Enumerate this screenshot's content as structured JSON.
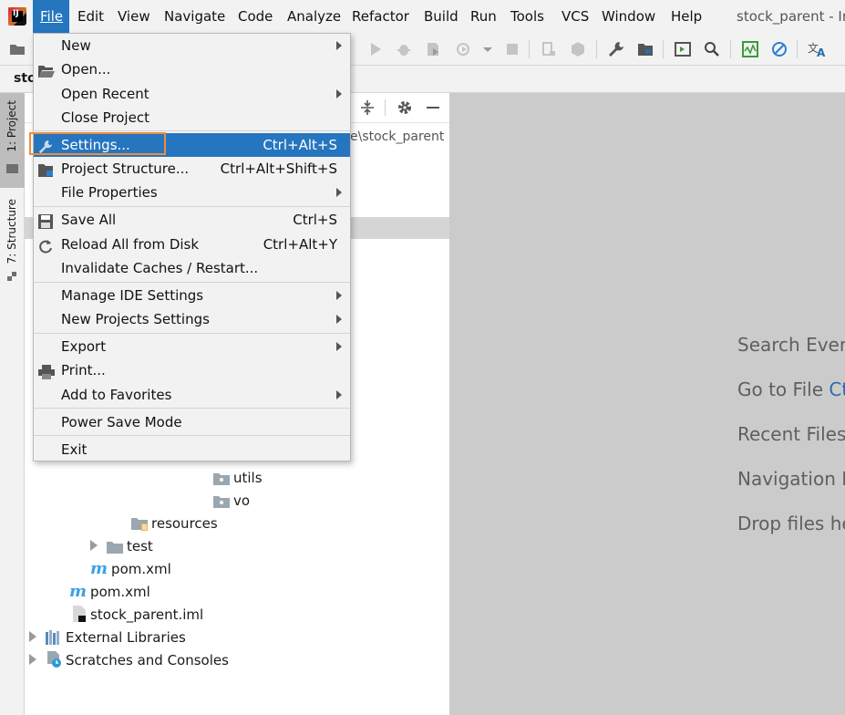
{
  "menubar": {
    "items": [
      "File",
      "Edit",
      "View",
      "Navigate",
      "Code",
      "Analyze",
      "Refactor",
      "Build",
      "Run",
      "Tools",
      "VCS",
      "Window",
      "Help"
    ],
    "window_title": "stock_parent - In"
  },
  "navbar": {
    "crumb": "stock"
  },
  "leftstrip": {
    "project_tab": "1: Project",
    "structure_tab": "7: Structure"
  },
  "project": {
    "path_fragment": "e\\stock_parent",
    "tree": [
      {
        "label": "utils",
        "kind": "folder"
      },
      {
        "label": "vo",
        "kind": "folder"
      },
      {
        "label": "resources",
        "kind": "resources"
      },
      {
        "label": "test",
        "kind": "folder"
      },
      {
        "label": "pom.xml",
        "kind": "maven"
      },
      {
        "label": "pom.xml",
        "kind": "maven"
      },
      {
        "label": "stock_parent.iml",
        "kind": "iml"
      },
      {
        "label": "External Libraries",
        "kind": "libraries"
      },
      {
        "label": "Scratches and Consoles",
        "kind": "scratches"
      }
    ]
  },
  "editor": {
    "hints": [
      {
        "text": "Search Every",
        "key": ""
      },
      {
        "text": "Go to File ",
        "key": "Ct"
      },
      {
        "text": "Recent Files",
        "key": ""
      },
      {
        "text": "Navigation B",
        "key": ""
      },
      {
        "text": "Drop files he",
        "key": ""
      }
    ]
  },
  "file_menu": {
    "items": [
      {
        "label": "New",
        "shortcut": "",
        "submenu": true
      },
      {
        "label": "Open...",
        "shortcut": "",
        "submenu": false,
        "icon": "folder-open-icon"
      },
      {
        "label": "Open Recent",
        "shortcut": "",
        "submenu": true
      },
      {
        "label": "Close Project",
        "shortcut": "",
        "submenu": false
      },
      {
        "label": "Settings...",
        "shortcut": "Ctrl+Alt+S",
        "submenu": false,
        "icon": "wrench-icon"
      },
      {
        "label": "Project Structure...",
        "shortcut": "Ctrl+Alt+Shift+S",
        "submenu": false,
        "icon": "project-structure-icon"
      },
      {
        "label": "File Properties",
        "shortcut": "",
        "submenu": true
      },
      {
        "label": "Save All",
        "shortcut": "Ctrl+S",
        "submenu": false,
        "icon": "save-icon"
      },
      {
        "label": "Reload All from Disk",
        "shortcut": "Ctrl+Alt+Y",
        "submenu": false,
        "icon": "reload-icon"
      },
      {
        "label": "Invalidate Caches / Restart...",
        "shortcut": "",
        "submenu": false
      },
      {
        "label": "Manage IDE Settings",
        "shortcut": "",
        "submenu": true
      },
      {
        "label": "New Projects Settings",
        "shortcut": "",
        "submenu": true
      },
      {
        "label": "Export",
        "shortcut": "",
        "submenu": true
      },
      {
        "label": "Print...",
        "shortcut": "",
        "submenu": false,
        "icon": "printer-icon"
      },
      {
        "label": "Add to Favorites",
        "shortcut": "",
        "submenu": true
      },
      {
        "label": "Power Save Mode",
        "shortcut": "",
        "submenu": false
      },
      {
        "label": "Exit",
        "shortcut": "",
        "submenu": false
      }
    ],
    "highlighted": "Settings..."
  },
  "colors": {
    "accent": "#2675bf",
    "focus": "#ee8c3a",
    "editor_bg": "#cbcbcb"
  }
}
